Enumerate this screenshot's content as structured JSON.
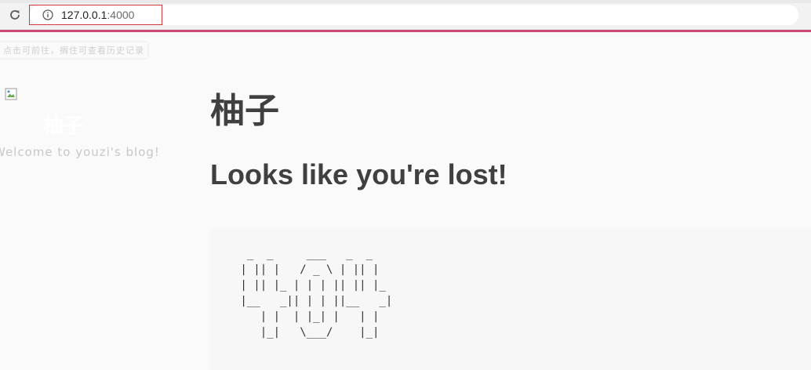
{
  "browser": {
    "address_bar": {
      "host": "127.0.0.1",
      "port": ":4000",
      "security_icon": "info-icon"
    },
    "reload_icon": "reload-icon"
  },
  "history_tip": "点击可前往，搁住可查看历史记录",
  "sidebar": {
    "site_title": "柚子",
    "subtitle": "Welcome to youzi's blog!",
    "avatar_icon": "broken-image-icon"
  },
  "main": {
    "page_title": "柚子",
    "lost_heading": "Looks like you're lost!",
    "ascii_404": "  _  _     ___   _  _  \n | || |   / _ \\ | || | \n | || |_ | | | || || |_\n |__   _|| | | ||__   _|\n    | |  | |_| |   | |  \n    |_|   \\___/    |_|  "
  },
  "colors": {
    "accent_line": "#cc4a78",
    "heading_text": "#404040",
    "page_background": "#fafafa"
  }
}
